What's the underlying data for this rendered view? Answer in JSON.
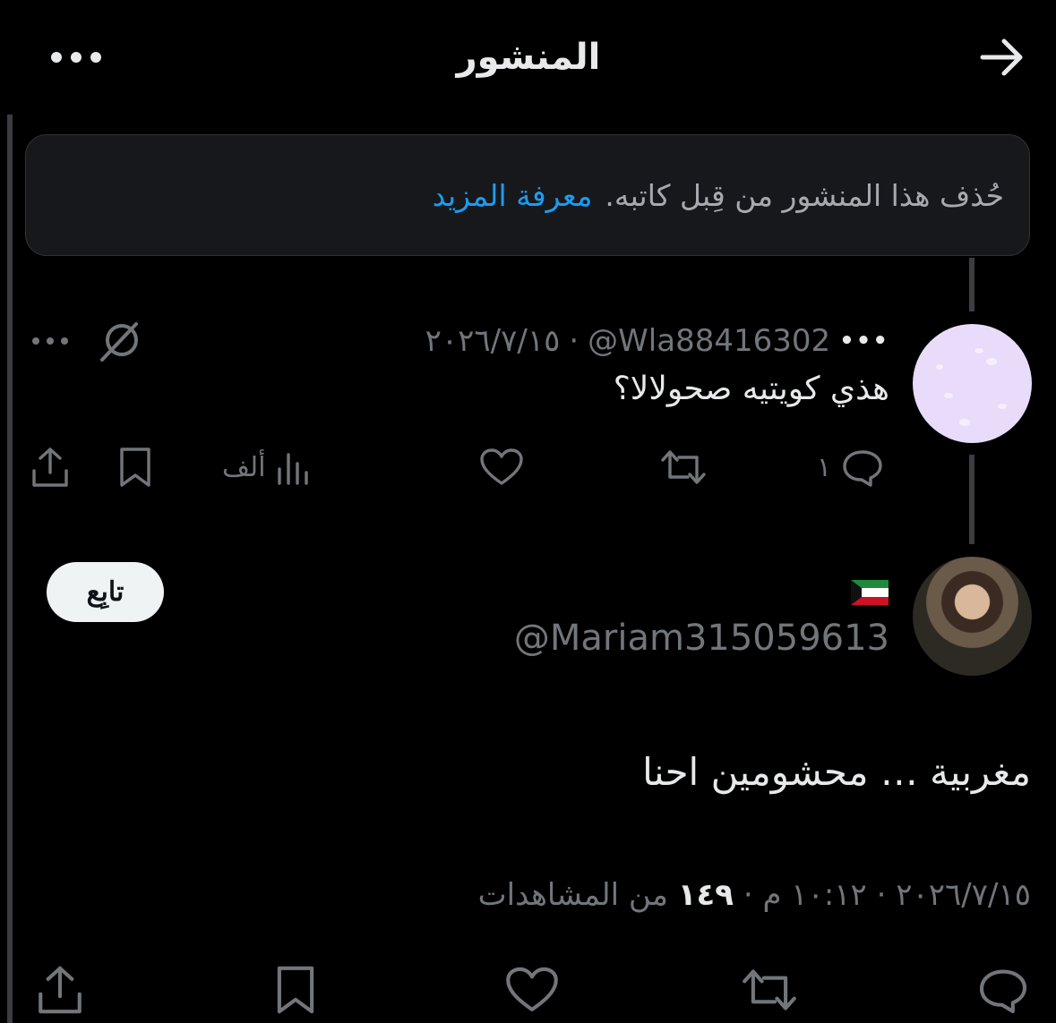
{
  "header": {
    "title": "المنشور",
    "back_icon": "arrow-right-icon",
    "more_icon": "more-horizontal-icon"
  },
  "deleted_notice": {
    "text": "حُذف هذا المنشور من قِبل كاتبه.",
    "link": "معرفة المزيد"
  },
  "reply": {
    "handle": "@Wla88416302",
    "separator": "·",
    "date": "٢٠٢٦/٧/١٥",
    "dots": "•••",
    "text": "هذي كويتيه صحولالا؟",
    "actions": {
      "replies": "١",
      "reposts": "",
      "likes": "",
      "views": "ألف",
      "bookmark": "",
      "share": ""
    }
  },
  "post": {
    "follow_label": "تابِع",
    "handle": "@Mariam315059613",
    "flag_icon": "kuwait-flag-icon",
    "text": "مغربية … محشومين احنا",
    "meta_prefix": "٢٠٢٦/٧/١٥ · ١٠:١٢ م · ",
    "views_count": "١٤٩",
    "views_label": " من المشاهدات"
  },
  "colors": {
    "background": "#000000",
    "text": "#e7e9ea",
    "muted": "#71767b",
    "link": "#1d9bf0",
    "avatar_reply": "#e8dcfa"
  }
}
